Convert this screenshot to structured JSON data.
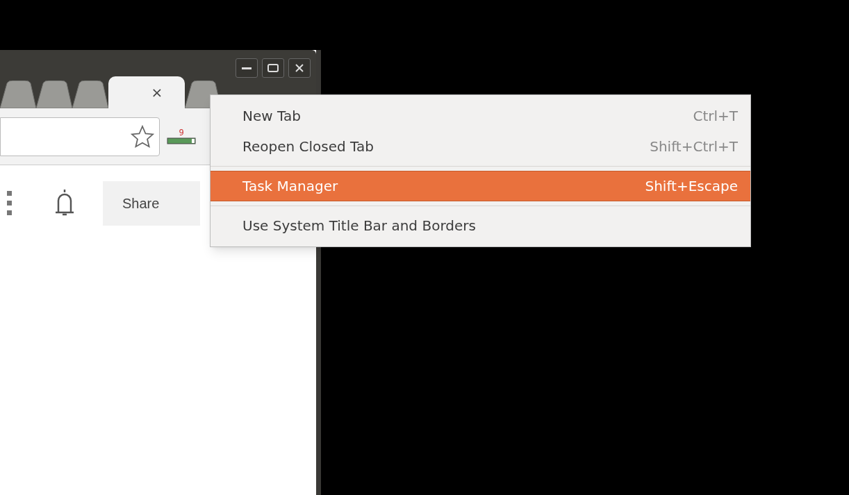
{
  "browser": {
    "tabs": [
      {
        "selected": false
      },
      {
        "selected": false
      },
      {
        "selected": false
      },
      {
        "selected": true,
        "close": "×"
      },
      {
        "selected": false
      }
    ],
    "extension_badge": "9",
    "share_button": "Share"
  },
  "context_menu": {
    "items": [
      {
        "kind": "item",
        "label": "New Tab",
        "shortcut": "Ctrl+T",
        "selected": false
      },
      {
        "kind": "item",
        "label": "Reopen Closed Tab",
        "shortcut": "Shift+Ctrl+T",
        "selected": false
      },
      {
        "kind": "separator"
      },
      {
        "kind": "item",
        "label": "Task Manager",
        "shortcut": "Shift+Escape",
        "selected": true
      },
      {
        "kind": "separator"
      },
      {
        "kind": "item",
        "label": "Use System Title Bar and Borders",
        "selected": false
      }
    ]
  }
}
